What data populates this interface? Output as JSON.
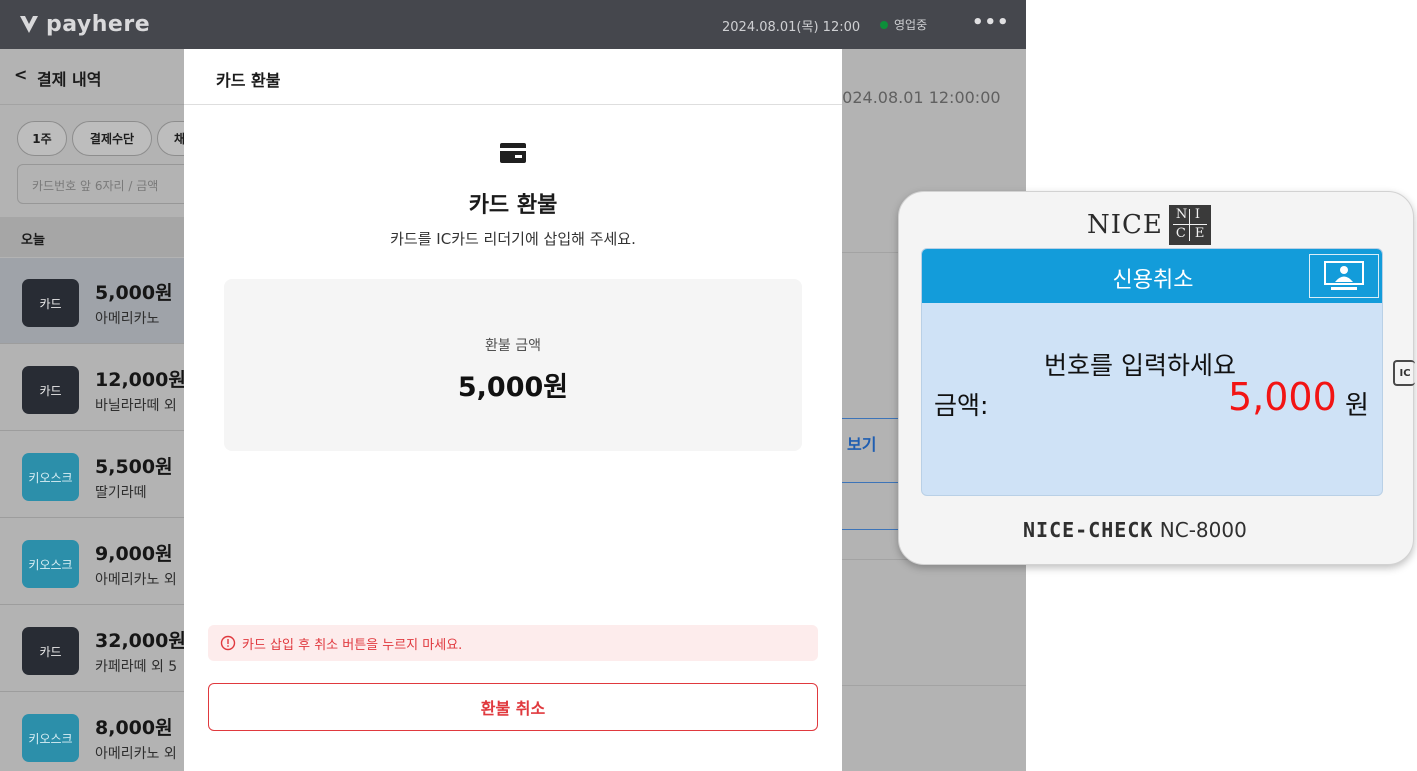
{
  "topbar": {
    "logo_text": "payhere",
    "datetime": "2024.08.01(목) 12:00",
    "status": "영업중",
    "more_label": "•••",
    "colors": {
      "status_dot": "#0d8f3a",
      "bar": "#45474d"
    }
  },
  "left_panel": {
    "title": "결제 내역",
    "back_label": "<",
    "filters": [
      "1주",
      "결제수단",
      "채"
    ],
    "search_placeholder": "카드번호 앞 6자리 / 금액",
    "section": "오늘",
    "items": [
      {
        "tag": "카드",
        "tag_type": "card",
        "amount": "5,000원",
        "desc": "아메리카노",
        "selected": true
      },
      {
        "tag": "카드",
        "tag_type": "card",
        "amount": "12,000원",
        "desc": "바닐라라떼 외",
        "selected": false
      },
      {
        "tag": "키오스크",
        "tag_type": "kiosk",
        "amount": "5,500원",
        "desc": "딸기라떼",
        "selected": false
      },
      {
        "tag": "키오스크",
        "tag_type": "kiosk",
        "amount": "9,000원",
        "desc": "아메리카노 외",
        "selected": false
      },
      {
        "tag": "카드",
        "tag_type": "card",
        "amount": "32,000원",
        "desc": "카페라떼 외 5",
        "selected": false
      },
      {
        "tag": "키오스크",
        "tag_type": "kiosk",
        "amount": "8,000원",
        "desc": "아메리카노 외",
        "selected": false
      }
    ]
  },
  "right_panel": {
    "datetime": "2024.08.01 12:00:00",
    "link_label": "보기"
  },
  "modal": {
    "title": "카드 환불",
    "icon": "credit-card-icon",
    "heading": "카드 환불",
    "subtitle": "카드를 IC카드 리더기에 삽입해 주세요.",
    "refund_label": "환불 금액",
    "refund_amount": "5,000원",
    "warning": "카드 삽입 후 취소 버튼을 누르지 마세요.",
    "cancel_label": "환불 취소",
    "colors": {
      "danger": "#e0393e",
      "warning_bg": "#fdecec"
    }
  },
  "terminal": {
    "brand": "NICE",
    "brand_box": [
      "N",
      "I",
      "C",
      "E"
    ],
    "screen_title": "신용취소",
    "prompt": "번호를 입력하세요",
    "amount_label": "금액:",
    "amount": "5,000",
    "unit": "원",
    "model_name": "NICE-CHECK",
    "model_number": "NC-8000",
    "side_label": "IC",
    "colors": {
      "screen_bar": "#139cda",
      "screen_bg": "#cfe2f6",
      "amount": "#f21414"
    }
  }
}
